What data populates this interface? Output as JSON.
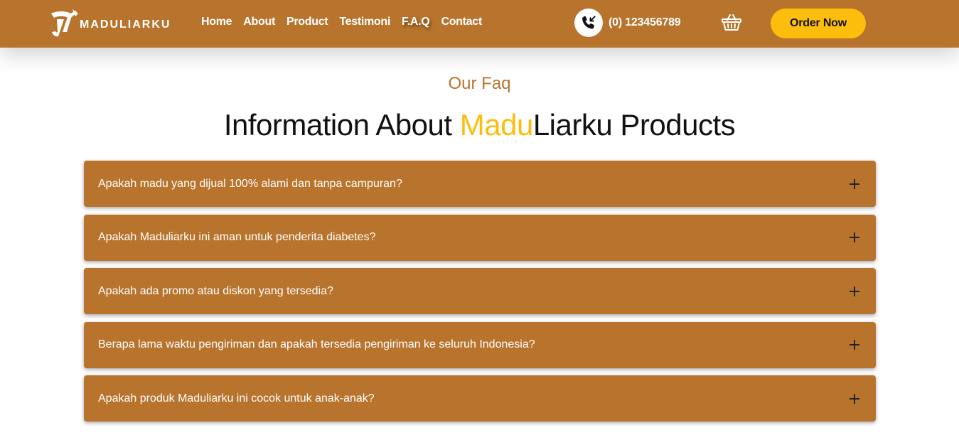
{
  "brand": {
    "name": "MADULIARKU"
  },
  "nav": {
    "links": [
      "Home",
      "About",
      "Product",
      "Testimoni",
      "F.A.Q",
      "Contact"
    ],
    "active": "F.A.Q"
  },
  "contact": {
    "phone": "(0) 123456789",
    "phone_icon": "phone-incoming-icon"
  },
  "cart": {
    "icon": "basket-icon"
  },
  "cta": {
    "label": "Order Now"
  },
  "faq": {
    "subtitle": "Our Faq",
    "title_prefix": "Information About ",
    "title_highlight": "Madu",
    "title_suffix": "Liarku Products",
    "toggle_icon": "plus-icon",
    "items": [
      "Apakah madu yang dijual 100% alami dan tanpa campuran?",
      "Apakah Maduliarku ini aman untuk penderita diabetes?",
      "Apakah ada promo atau diskon yang tersedia?",
      "Berapa lama waktu pengiriman dan apakah tersedia pengiriman ke seluruh Indonesia?",
      "Apakah produk Maduliarku ini cocok untuk anak-anak?"
    ]
  },
  "colors": {
    "primary": "#b8742d",
    "accent": "#fcbd0d",
    "text_dark": "#111111",
    "white": "#ffffff"
  }
}
